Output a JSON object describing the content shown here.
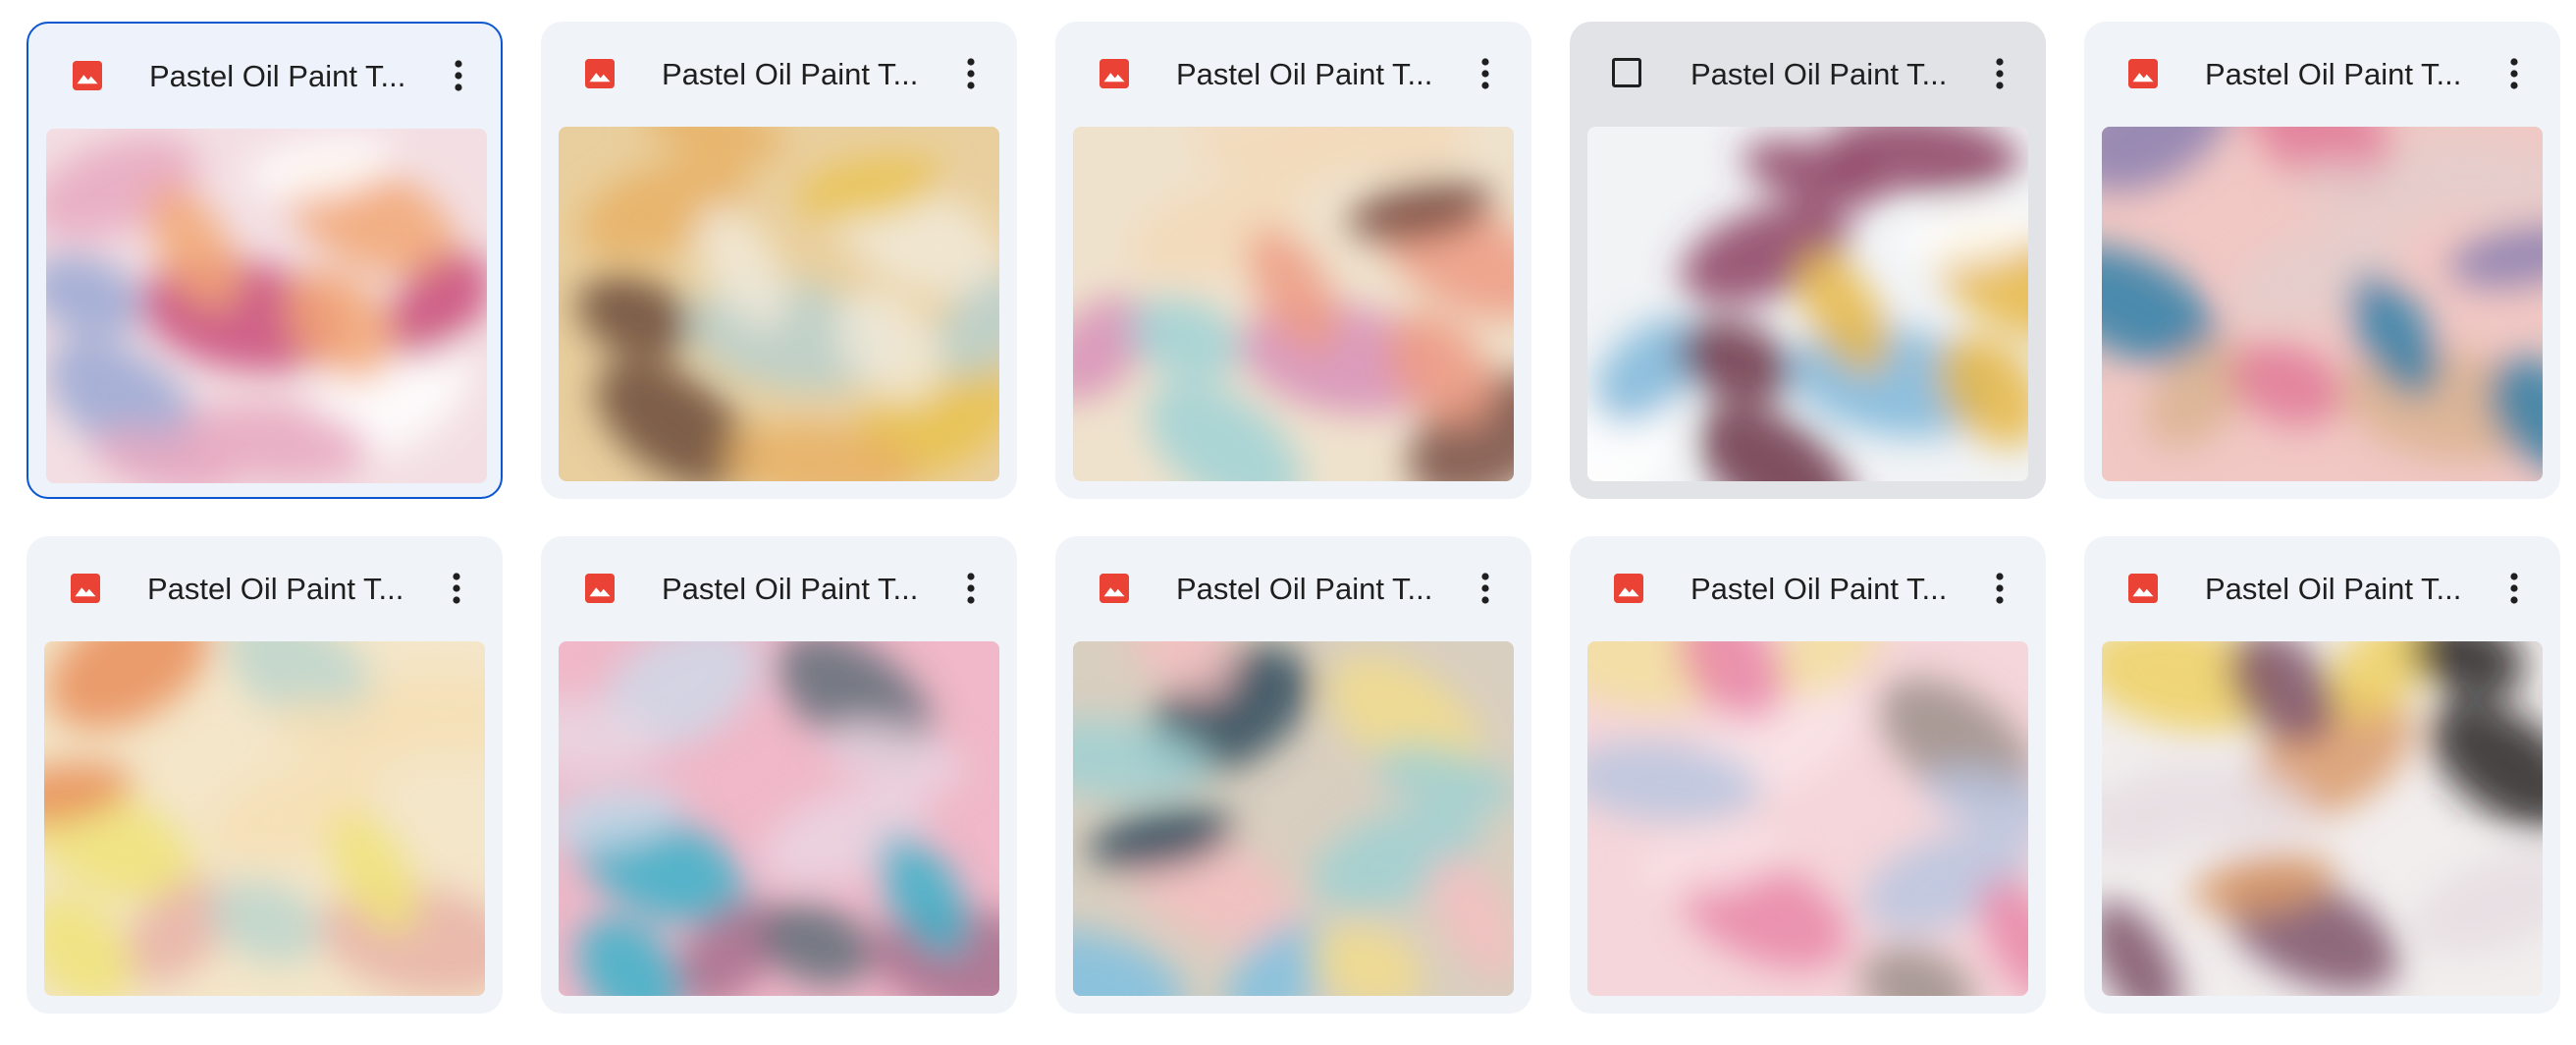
{
  "files": [
    {
      "title": "Pastel Oil Paint T...",
      "state": "selected",
      "icon": "image-file-icon",
      "colors": [
        "#f3dfe3",
        "#e8a8c0",
        "#f2a774",
        "#c94a78",
        "#9aa8d4",
        "#ffffff"
      ]
    },
    {
      "title": "Pastel Oil Paint T...",
      "state": "normal",
      "icon": "image-file-icon",
      "colors": [
        "#e9cf9e",
        "#e8b065",
        "#f1ead9",
        "#b8d0cf",
        "#6b4a3a",
        "#e9c24d"
      ]
    },
    {
      "title": "Pastel Oil Paint T...",
      "state": "normal",
      "icon": "image-file-icon",
      "colors": [
        "#efe2cd",
        "#f3d9b9",
        "#ef9c84",
        "#d78fb8",
        "#9fd2d6",
        "#7a5044"
      ]
    },
    {
      "title": "Pastel Oil Paint T...",
      "state": "hovered",
      "icon": "checkbox-icon",
      "colors": [
        "#f1f3f5",
        "#8c3f62",
        "#e8b744",
        "#7db6d9",
        "#6b3444",
        "#ffffff"
      ]
    },
    {
      "title": "Pastel Oil Paint T...",
      "state": "normal",
      "icon": "image-file-icon",
      "colors": [
        "#f1c8c4",
        "#e4cfcd",
        "#2e7fa8",
        "#d9b38f",
        "#e07a98",
        "#8a7fb0"
      ]
    },
    {
      "title": "Pastel Oil Paint T...",
      "state": "normal",
      "icon": "image-file-icon",
      "colors": [
        "#f4e6c9",
        "#f6dfb5",
        "#efe37a",
        "#e7b2a7",
        "#bcd5cc",
        "#e98e5c"
      ]
    },
    {
      "title": "Pastel Oil Paint T...",
      "state": "normal",
      "icon": "image-file-icon",
      "colors": [
        "#f0b8c8",
        "#ead5e2",
        "#3bb3c9",
        "#a66f8c",
        "#5f6e78",
        "#cfd8e8"
      ]
    },
    {
      "title": "Pastel Oil Paint T...",
      "state": "normal",
      "icon": "image-file-icon",
      "colors": [
        "#d9cfc0",
        "#9fd0d2",
        "#f3bfc1",
        "#7fc0e0",
        "#f1dc8c",
        "#2d4a5c"
      ]
    },
    {
      "title": "Pastel Oil Paint T...",
      "state": "normal",
      "icon": "image-file-icon",
      "colors": [
        "#f5d6da",
        "#b9c6df",
        "#e986a8",
        "#f2df9f",
        "#9c8f8a",
        "#f9e4e8"
      ]
    },
    {
      "title": "Pastel Oil Paint T...",
      "state": "normal",
      "icon": "image-file-icon",
      "colors": [
        "#f2eeee",
        "#e6dde2",
        "#7d5268",
        "#efd060",
        "#2b2426",
        "#d99a6a"
      ]
    }
  ],
  "theme": {
    "accent": "#0b57d0",
    "file_icon_red": "#ea4335"
  }
}
